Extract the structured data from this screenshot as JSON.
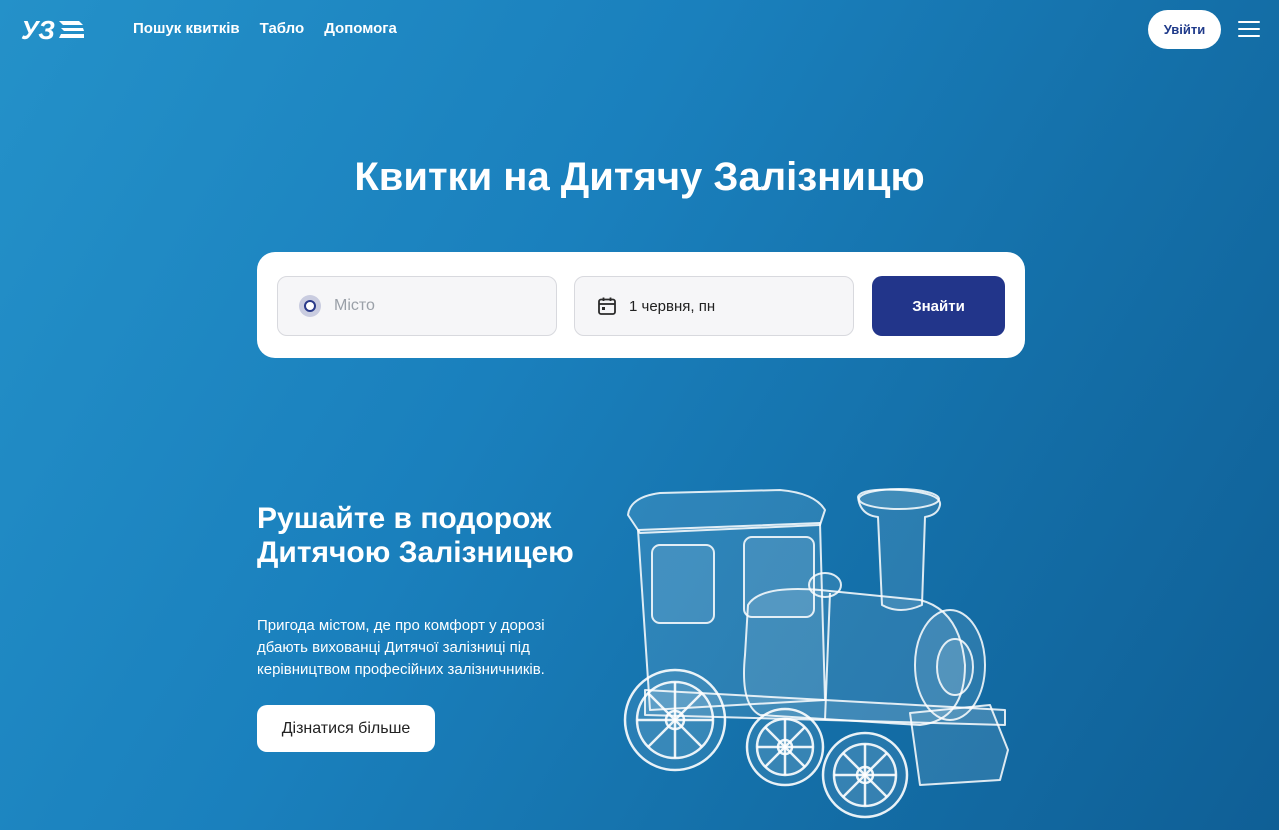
{
  "header": {
    "logo_text": "УЗ",
    "nav": [
      "Пошук квитків",
      "Табло",
      "Допомога"
    ],
    "login_label": "Увійти"
  },
  "hero": {
    "title": "Квитки на Дитячу Залізницю"
  },
  "search": {
    "city_placeholder": "Місто",
    "date_value": "1 червня, пн",
    "find_label": "Знайти"
  },
  "promo": {
    "title": "Рушайте в подорож Дитячою Залізницею",
    "text": "Пригода містом, де про комфорт у дорозі дбають вихованці Дитячої залізниці під керівництвом професійних залізничників.",
    "button_label": "Дізнатися більше"
  },
  "icons": {
    "logo": "uz-logo-icon",
    "menu": "hamburger-menu-icon",
    "city": "location-dot-icon",
    "date": "calendar-icon",
    "illustration": "glass-toy-train-image"
  },
  "colors": {
    "background_start": "#2491c9",
    "background_end": "#0f5f96",
    "primary_button": "#22358a",
    "login_text": "#1f3a8a"
  }
}
